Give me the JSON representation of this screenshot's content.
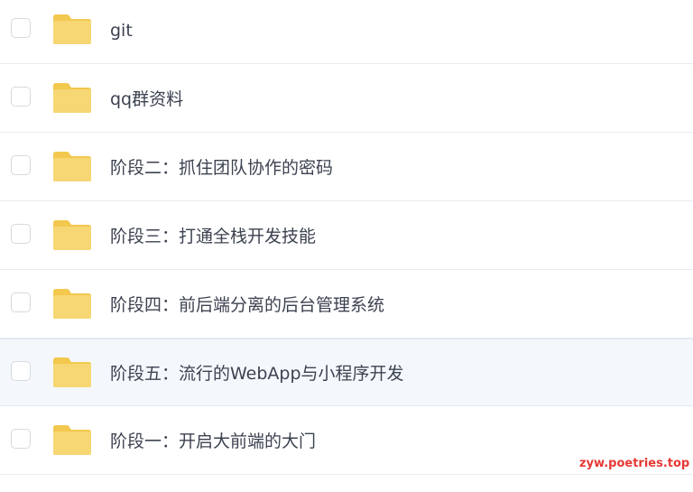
{
  "file_list": {
    "rows": [
      {
        "label": "git",
        "selected": false,
        "icon": "folder-icon"
      },
      {
        "label": "qq群资料",
        "selected": false,
        "icon": "folder-icon"
      },
      {
        "label": "阶段二：抓住团队协作的密码",
        "selected": false,
        "icon": "folder-icon"
      },
      {
        "label": "阶段三：打通全栈开发技能",
        "selected": false,
        "icon": "folder-icon"
      },
      {
        "label": "阶段四：前后端分离的后台管理系统",
        "selected": false,
        "icon": "folder-icon"
      },
      {
        "label": "阶段五：流行的WebApp与小程序开发",
        "selected": false,
        "icon": "folder-icon",
        "hovered": true
      },
      {
        "label": "阶段一：开启大前端的大门",
        "selected": false,
        "icon": "folder-icon"
      }
    ]
  },
  "watermark": {
    "text": "zyw.poetries.top"
  },
  "colors": {
    "folder": "#f7d774",
    "folder_tab": "#f2c84e",
    "hover_row": "#f4f8fd",
    "text": "#3c4250",
    "watermark": "#e53935"
  }
}
